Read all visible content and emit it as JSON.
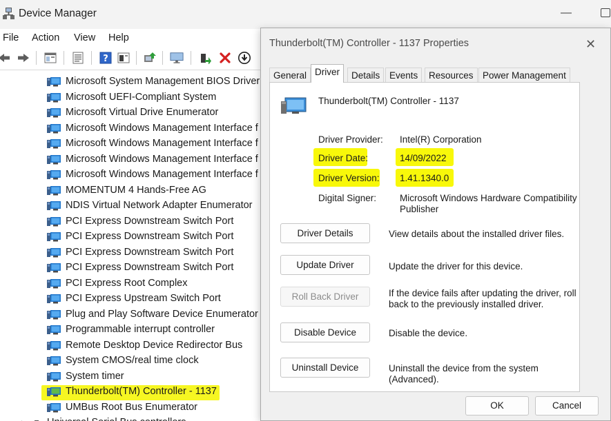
{
  "device_manager": {
    "title": "Device Manager",
    "menu": [
      "File",
      "Action",
      "View",
      "Help"
    ],
    "toolbar_icons": [
      "back-arrow-icon",
      "forward-arrow-icon",
      "properties-icon",
      "list-icon",
      "help-icon",
      "device-view-icon",
      "update-driver-icon",
      "monitor-icon",
      "enable-device-icon",
      "uninstall-x-icon",
      "download-icon"
    ],
    "devices": [
      "Microsoft System Management BIOS Driver",
      "Microsoft UEFI-Compliant System",
      "Microsoft Virtual Drive Enumerator",
      "Microsoft Windows Management Interface f",
      "Microsoft Windows Management Interface f",
      "Microsoft Windows Management Interface f",
      "Microsoft Windows Management Interface f",
      "MOMENTUM 4 Hands-Free AG",
      "NDIS Virtual Network Adapter Enumerator",
      "PCI Express Downstream Switch Port",
      "PCI Express Downstream Switch Port",
      "PCI Express Downstream Switch Port",
      "PCI Express Downstream Switch Port",
      "PCI Express Root Complex",
      "PCI Express Upstream Switch Port",
      "Plug and Play Software Device Enumerator",
      "Programmable interrupt controller",
      "Remote Desktop Device Redirector Bus",
      "System CMOS/real time clock",
      "System timer",
      "Thunderbolt(TM) Controller - 1137",
      "UMBus Root Bus Enumerator",
      "Universal Serial Bus controllers"
    ],
    "highlight_color": "#f5f50a"
  },
  "properties": {
    "title": "Thunderbolt(TM) Controller - 1137 Properties",
    "tabs": [
      "General",
      "Driver",
      "Details",
      "Events",
      "Resources",
      "Power Management"
    ],
    "active_tab": "Driver",
    "device_name": "Thunderbolt(TM) Controller - 1137",
    "driver_provider_label": "Driver Provider:",
    "driver_provider": "Intel(R) Corporation",
    "driver_date_label": "Driver Date:",
    "driver_date": "14/09/2022",
    "driver_version_label": "Driver Version:",
    "driver_version": "1.41.1340.0",
    "digital_signer_label": "Digital Signer:",
    "digital_signer_line1": "Microsoft Windows Hardware Compatibility",
    "digital_signer_line2": "Publisher",
    "buttons": {
      "driver_details": "Driver Details",
      "update_driver": "Update Driver",
      "roll_back_driver": "Roll Back Driver",
      "disable_device": "Disable Device",
      "uninstall_device": "Uninstall Device"
    },
    "descriptions": {
      "driver_details": "View details about the installed driver files.",
      "update_driver": "Update the driver for this device.",
      "roll_back_line1": "If the device fails after updating the driver, roll",
      "roll_back_line2": "back to the previously installed driver.",
      "disable_device": "Disable the device.",
      "uninstall_device": "Uninstall the device from the system (Advanced)."
    },
    "ok": "OK",
    "cancel": "Cancel"
  }
}
